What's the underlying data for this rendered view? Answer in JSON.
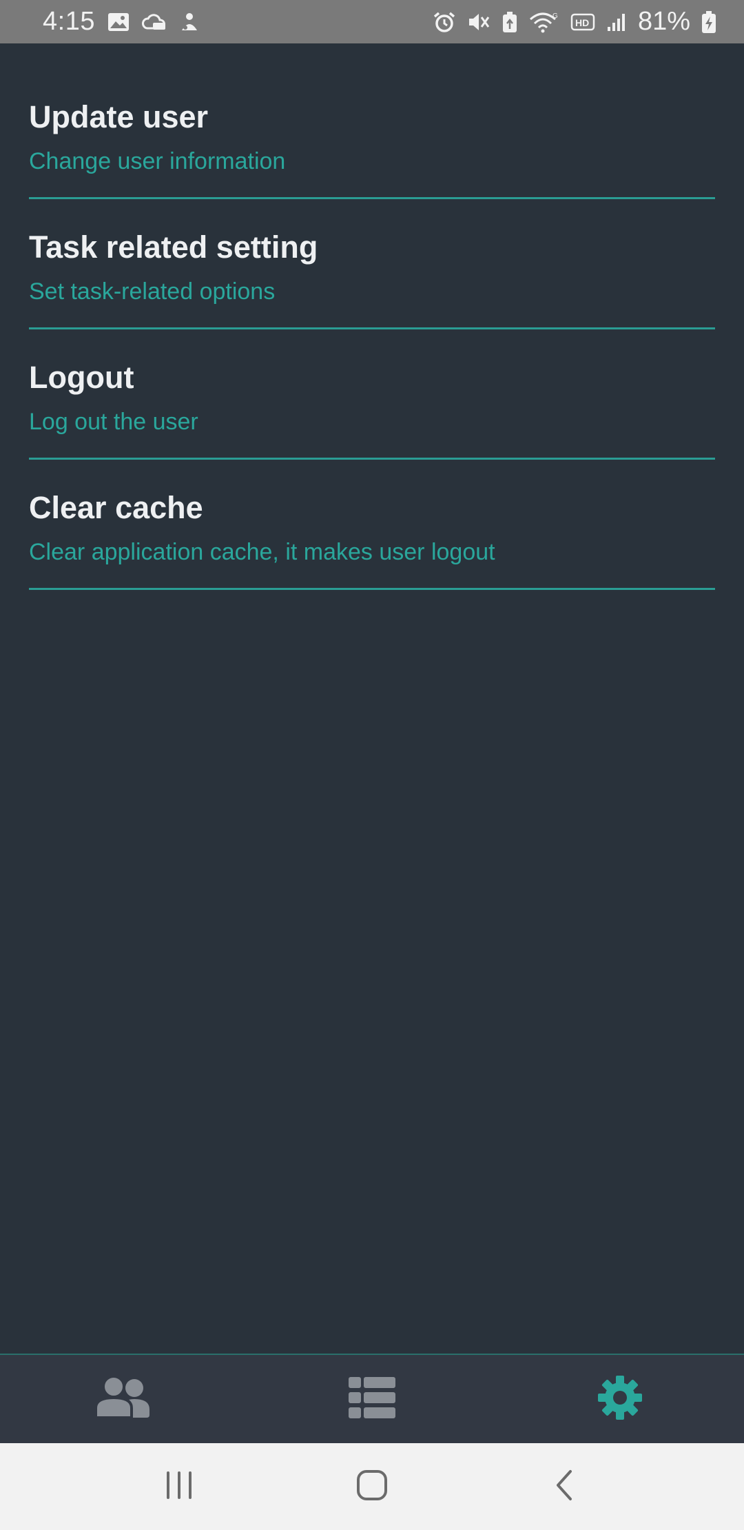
{
  "status_bar": {
    "time": "4:15",
    "battery_percent": "81%",
    "left_icons": [
      "image-icon",
      "cloud-icon",
      "app-notification-icon"
    ],
    "right_icons": [
      "alarm-icon",
      "mute-icon",
      "battery-saver-icon",
      "wifi-icon",
      "hd-icon",
      "signal-icon",
      "battery-charging-icon"
    ]
  },
  "settings": {
    "items": [
      {
        "title": "Update user",
        "subtitle": "Change user information"
      },
      {
        "title": "Task related setting",
        "subtitle": "Set task-related options"
      },
      {
        "title": "Logout",
        "subtitle": "Log out the user"
      },
      {
        "title": "Clear cache",
        "subtitle": "Clear application cache, it makes user logout"
      }
    ]
  },
  "bottom_nav": {
    "tabs": [
      {
        "icon": "users-icon",
        "active": false
      },
      {
        "icon": "list-icon",
        "active": false
      },
      {
        "icon": "gear-icon",
        "active": true
      }
    ],
    "active_color": "#2aa79c",
    "inactive_color": "#8a8f96"
  },
  "system_nav": {
    "buttons": [
      "recent-apps-icon",
      "home-icon",
      "back-icon"
    ]
  },
  "colors": {
    "background": "#29323b",
    "accent": "#2aa79c",
    "status_bar": "#7a7a7a"
  }
}
